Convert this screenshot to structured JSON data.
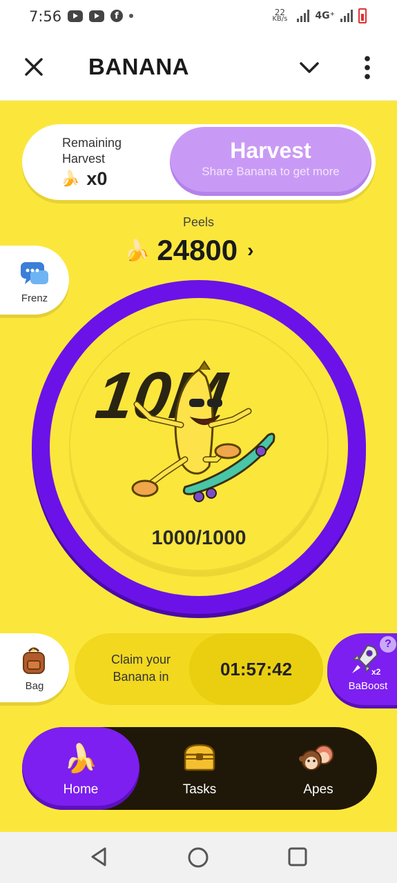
{
  "status_bar": {
    "time": "7:56",
    "speed_value": "22",
    "speed_unit": "KB/s",
    "network": "4G⁺",
    "icons": [
      "youtube-icon",
      "youtube-icon",
      "facebook-icon",
      "notification-dot",
      "signal-icon",
      "signal-icon",
      "battery-icon"
    ]
  },
  "header": {
    "title": "BANANA",
    "icons": [
      "close-icon",
      "chevron-down-icon",
      "more-vertical-icon"
    ]
  },
  "harvest": {
    "label": "Remaining Harvest",
    "value": "x0",
    "button_title": "Harvest",
    "button_subtitle": "Share Banana to get more"
  },
  "peels": {
    "label": "Peels",
    "value": "24800",
    "arrow": "›"
  },
  "side_left": {
    "frenz_label": "Frenz",
    "bag_label": "Bag"
  },
  "center": {
    "art_text": "10M",
    "counter": "1000/1000"
  },
  "claim": {
    "text": "Claim your Banana in",
    "timer": "01:57:42"
  },
  "boost": {
    "label": "BaBoost",
    "multiplier": "x2",
    "help": "?"
  },
  "bottom_nav": {
    "items": [
      {
        "label": "Home",
        "icon": "banana-icon",
        "active": true
      },
      {
        "label": "Tasks",
        "icon": "treasure-chest-icon",
        "active": false
      },
      {
        "label": "Apes",
        "icon": "monkeys-icon",
        "active": false
      }
    ]
  },
  "colors": {
    "background": "#fbe73c",
    "accent_purple": "#6b12e8",
    "harvest_button": "#c99af5",
    "nav_dark": "#1f1808"
  }
}
